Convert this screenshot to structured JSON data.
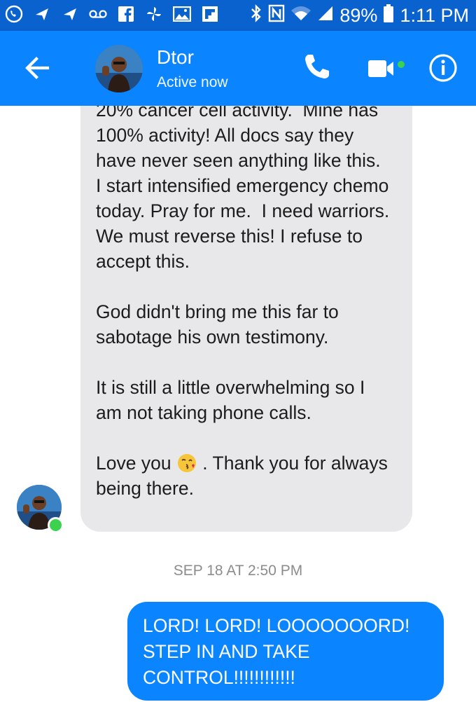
{
  "status_bar": {
    "battery": "89%",
    "time": "1:11 PM",
    "icons_left": [
      "viber-icon",
      "notification-arrow-icon",
      "notification-arrow-icon",
      "voicemail-icon",
      "facebook-icon",
      "pinwheel-icon",
      "gallery-icon",
      "flipboard-icon"
    ],
    "icons_right": [
      "bluetooth-icon",
      "nfc-icon",
      "wifi-icon",
      "signal-icon",
      "battery-icon"
    ]
  },
  "header": {
    "contact_name": "Dtor",
    "status": "Active now",
    "icons": [
      "back-arrow-icon",
      "phone-icon",
      "video-camera-icon",
      "info-icon"
    ]
  },
  "messages": {
    "incoming_text": "20% cancer cell activity.  Mine has 100% activity! All docs say they have never seen anything like this. I start intensified emergency chemo today. Pray for me.  I need warriors. We must reverse this! I refuse to accept this.\n\nGod didn't bring me this far to sabotage his own testimony.\n\nIt is still a little overwhelming so I am not taking phone calls.\n\n",
    "incoming_love_prefix": "Love you ",
    "incoming_love_suffix": " . Thank you for always being there.",
    "incoming_emoji": "face-blowing-a-kiss-icon",
    "timestamp": "SEP 18 AT 2:50 PM",
    "outgoing_text": "LORD! LORD! LOOOOOOORD! STEP IN AND TAKE CONTROL!!!!!!!!!!!!"
  },
  "colors": {
    "status_bar": "#0a62cf",
    "header": "#0a84ff",
    "incoming_bubble": "#e8e8ea",
    "outgoing_bubble": "#0a84ff",
    "online": "#3cd24e"
  }
}
